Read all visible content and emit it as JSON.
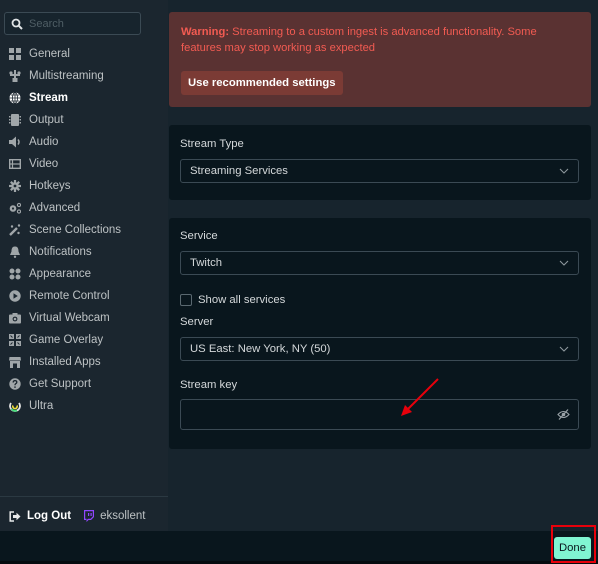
{
  "sidebar": {
    "search_placeholder": "Search",
    "items": [
      {
        "label": "General",
        "icon": "grid-icon",
        "active": false
      },
      {
        "label": "Multistreaming",
        "icon": "multistream-icon",
        "active": false
      },
      {
        "label": "Stream",
        "icon": "globe-icon",
        "active": true
      },
      {
        "label": "Output",
        "icon": "output-icon",
        "active": false
      },
      {
        "label": "Audio",
        "icon": "speaker-icon",
        "active": false
      },
      {
        "label": "Video",
        "icon": "film-icon",
        "active": false
      },
      {
        "label": "Hotkeys",
        "icon": "gear-icon",
        "active": false
      },
      {
        "label": "Advanced",
        "icon": "gears-icon",
        "active": false
      },
      {
        "label": "Scene Collections",
        "icon": "wand-icon",
        "active": false
      },
      {
        "label": "Notifications",
        "icon": "bell-icon",
        "active": false
      },
      {
        "label": "Appearance",
        "icon": "palette-icon",
        "active": false
      },
      {
        "label": "Remote Control",
        "icon": "play-circle-icon",
        "active": false
      },
      {
        "label": "Virtual Webcam",
        "icon": "camera-icon",
        "active": false
      },
      {
        "label": "Game Overlay",
        "icon": "expand-icon",
        "active": false
      },
      {
        "label": "Installed Apps",
        "icon": "store-icon",
        "active": false
      },
      {
        "label": "Get Support",
        "icon": "question-circle-icon",
        "active": false
      },
      {
        "label": "Ultra",
        "icon": "ultra-icon",
        "active": false
      }
    ],
    "footer": {
      "logout_label": "Log Out",
      "username": "eksollent",
      "platform_icon": "twitch-icon"
    }
  },
  "main": {
    "warning": {
      "prefix": "Warning:",
      "text": " Streaming to a custom ingest is advanced functionality. Some features may stop working as expected",
      "button_label": "Use recommended settings"
    },
    "stream_type": {
      "label": "Stream Type",
      "value": "Streaming Services"
    },
    "service": {
      "label": "Service",
      "value": "Twitch"
    },
    "show_all_services": {
      "label": "Show all services",
      "checked": false
    },
    "server": {
      "label": "Server",
      "value": "US East: New York, NY (50)"
    },
    "stream_key": {
      "label": "Stream key",
      "value": ""
    }
  },
  "footer": {
    "done_label": "Done"
  },
  "colors": {
    "warning_text": "#f25b52",
    "warning_bg": "#5a3232",
    "accent": "#80f5d2",
    "twitch": "#9146ff",
    "annotation": "#e8000b"
  }
}
